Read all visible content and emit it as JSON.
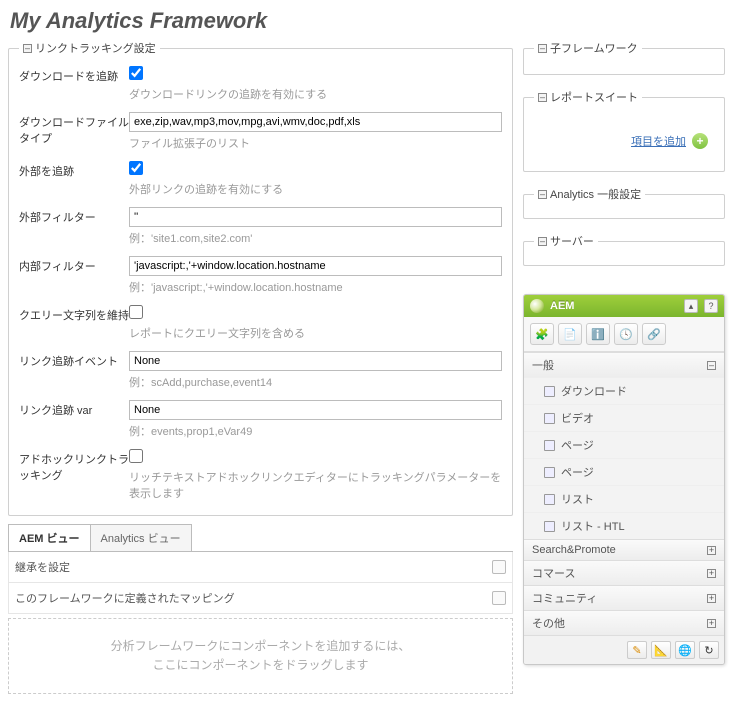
{
  "page_title": "My Analytics Framework",
  "linktrack": {
    "legend": "リンクトラッキング設定",
    "download": {
      "label": "ダウンロードを追跡",
      "hint": "ダウンロードリンクの追跡を有効にする"
    },
    "filetype": {
      "label": "ダウンロードファイルタイプ",
      "value": "exe,zip,wav,mp3,mov,mpg,avi,wmv,doc,pdf,xls",
      "hint": "ファイル拡張子のリスト"
    },
    "external": {
      "label": "外部を追跡",
      "hint": "外部リンクの追跡を有効にする"
    },
    "extfilter": {
      "label": "外部フィルター",
      "value": "''",
      "hint": "例：'site1.com,site2.com'"
    },
    "intfilter": {
      "label": "内部フィルター",
      "value": "'javascript:,'+window.location.hostname",
      "hint": "例：'javascript:,'+window.location.hostname"
    },
    "query": {
      "label": "クエリー文字列を維持",
      "hint": "レポートにクエリー文字列を含める"
    },
    "events": {
      "label": "リンク追跡イベント",
      "value": "None",
      "hint": "例：scAdd,purchase,event14"
    },
    "vars": {
      "label": "リンク追跡 var",
      "value": "None",
      "hint": "例：events,prop1,eVar49"
    },
    "adhoc": {
      "label": "アドホックリンクトラッキング",
      "hint": "リッチテキストアドホックリンクエディターにトラッキングパラメーターを表示します"
    }
  },
  "tabs": {
    "aem": "AEM ビュー",
    "analytics": "Analytics ビュー"
  },
  "rows": {
    "inherit": "継承を設定",
    "mapping": "このフレームワークに定義されたマッピング"
  },
  "dropzone": {
    "l1": "分析フレームワークにコンポーネントを追加するには、",
    "l2": "ここにコンポーネントをドラッグします"
  },
  "right": {
    "child": "子フレームワーク",
    "suite": "レポートスイート",
    "additem": "項目を追加",
    "analytics_general": "Analytics 一般設定",
    "server": "サーバー"
  },
  "sidekick": {
    "title": "AEM",
    "cats": {
      "general": "一般",
      "items": [
        "ダウンロード",
        "ビデオ",
        "ページ",
        "ページ",
        "リスト",
        "リスト - HTL"
      ],
      "search": "Search&Promote",
      "commerce": "コマース",
      "community": "コミュニティ",
      "other": "その他"
    }
  }
}
